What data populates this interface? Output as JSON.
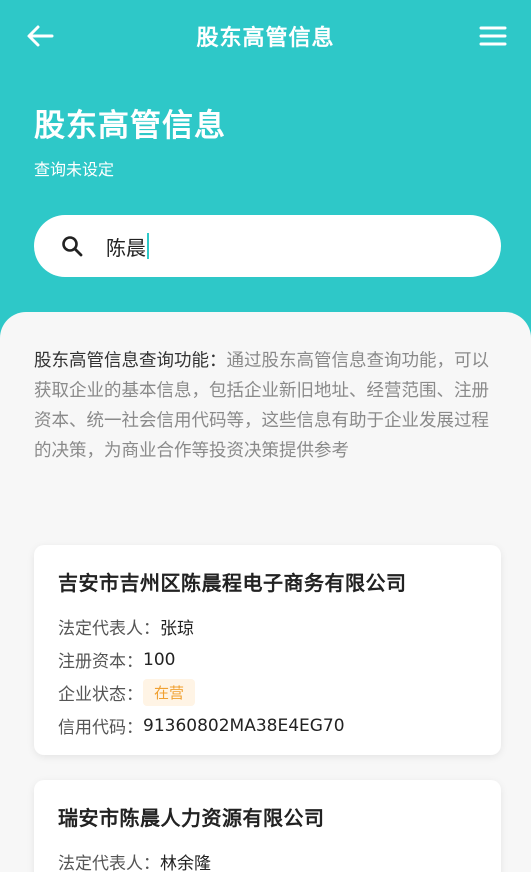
{
  "header": {
    "title": "股东高管信息"
  },
  "hero": {
    "title": "股东高管信息",
    "subtitle": "查询未设定"
  },
  "search": {
    "value": "陈晨"
  },
  "description": {
    "label": "股东高管信息查询功能：",
    "text": "通过股东高管信息查询功能，可以获取企业的基本信息，包括企业新旧地址、经营范围、注册资本、统一社会信用代码等，这些信息有助于企业发展过程的决策，为商业合作等投资决策提供参考"
  },
  "results": [
    {
      "name": "吉安市吉州区陈晨程电子商务有限公司",
      "legal_rep_label": "法定代表人：",
      "legal_rep": "张琼",
      "capital_label": "注册资本：",
      "capital": "100",
      "status_label": "企业状态：",
      "status": "在营",
      "credit_label": "信用代码：",
      "credit_code": "91360802MA38E4EG70"
    },
    {
      "name": "瑞安市陈晨人力资源有限公司",
      "legal_rep_label": "法定代表人：",
      "legal_rep": "林余隆"
    }
  ],
  "colors": {
    "primary": "#2EC8C8",
    "status_text": "#F0A030",
    "status_bg": "#FFF4E5"
  },
  "icons": {
    "back": "arrow-left-icon",
    "menu": "menu-icon",
    "search": "search-icon"
  }
}
